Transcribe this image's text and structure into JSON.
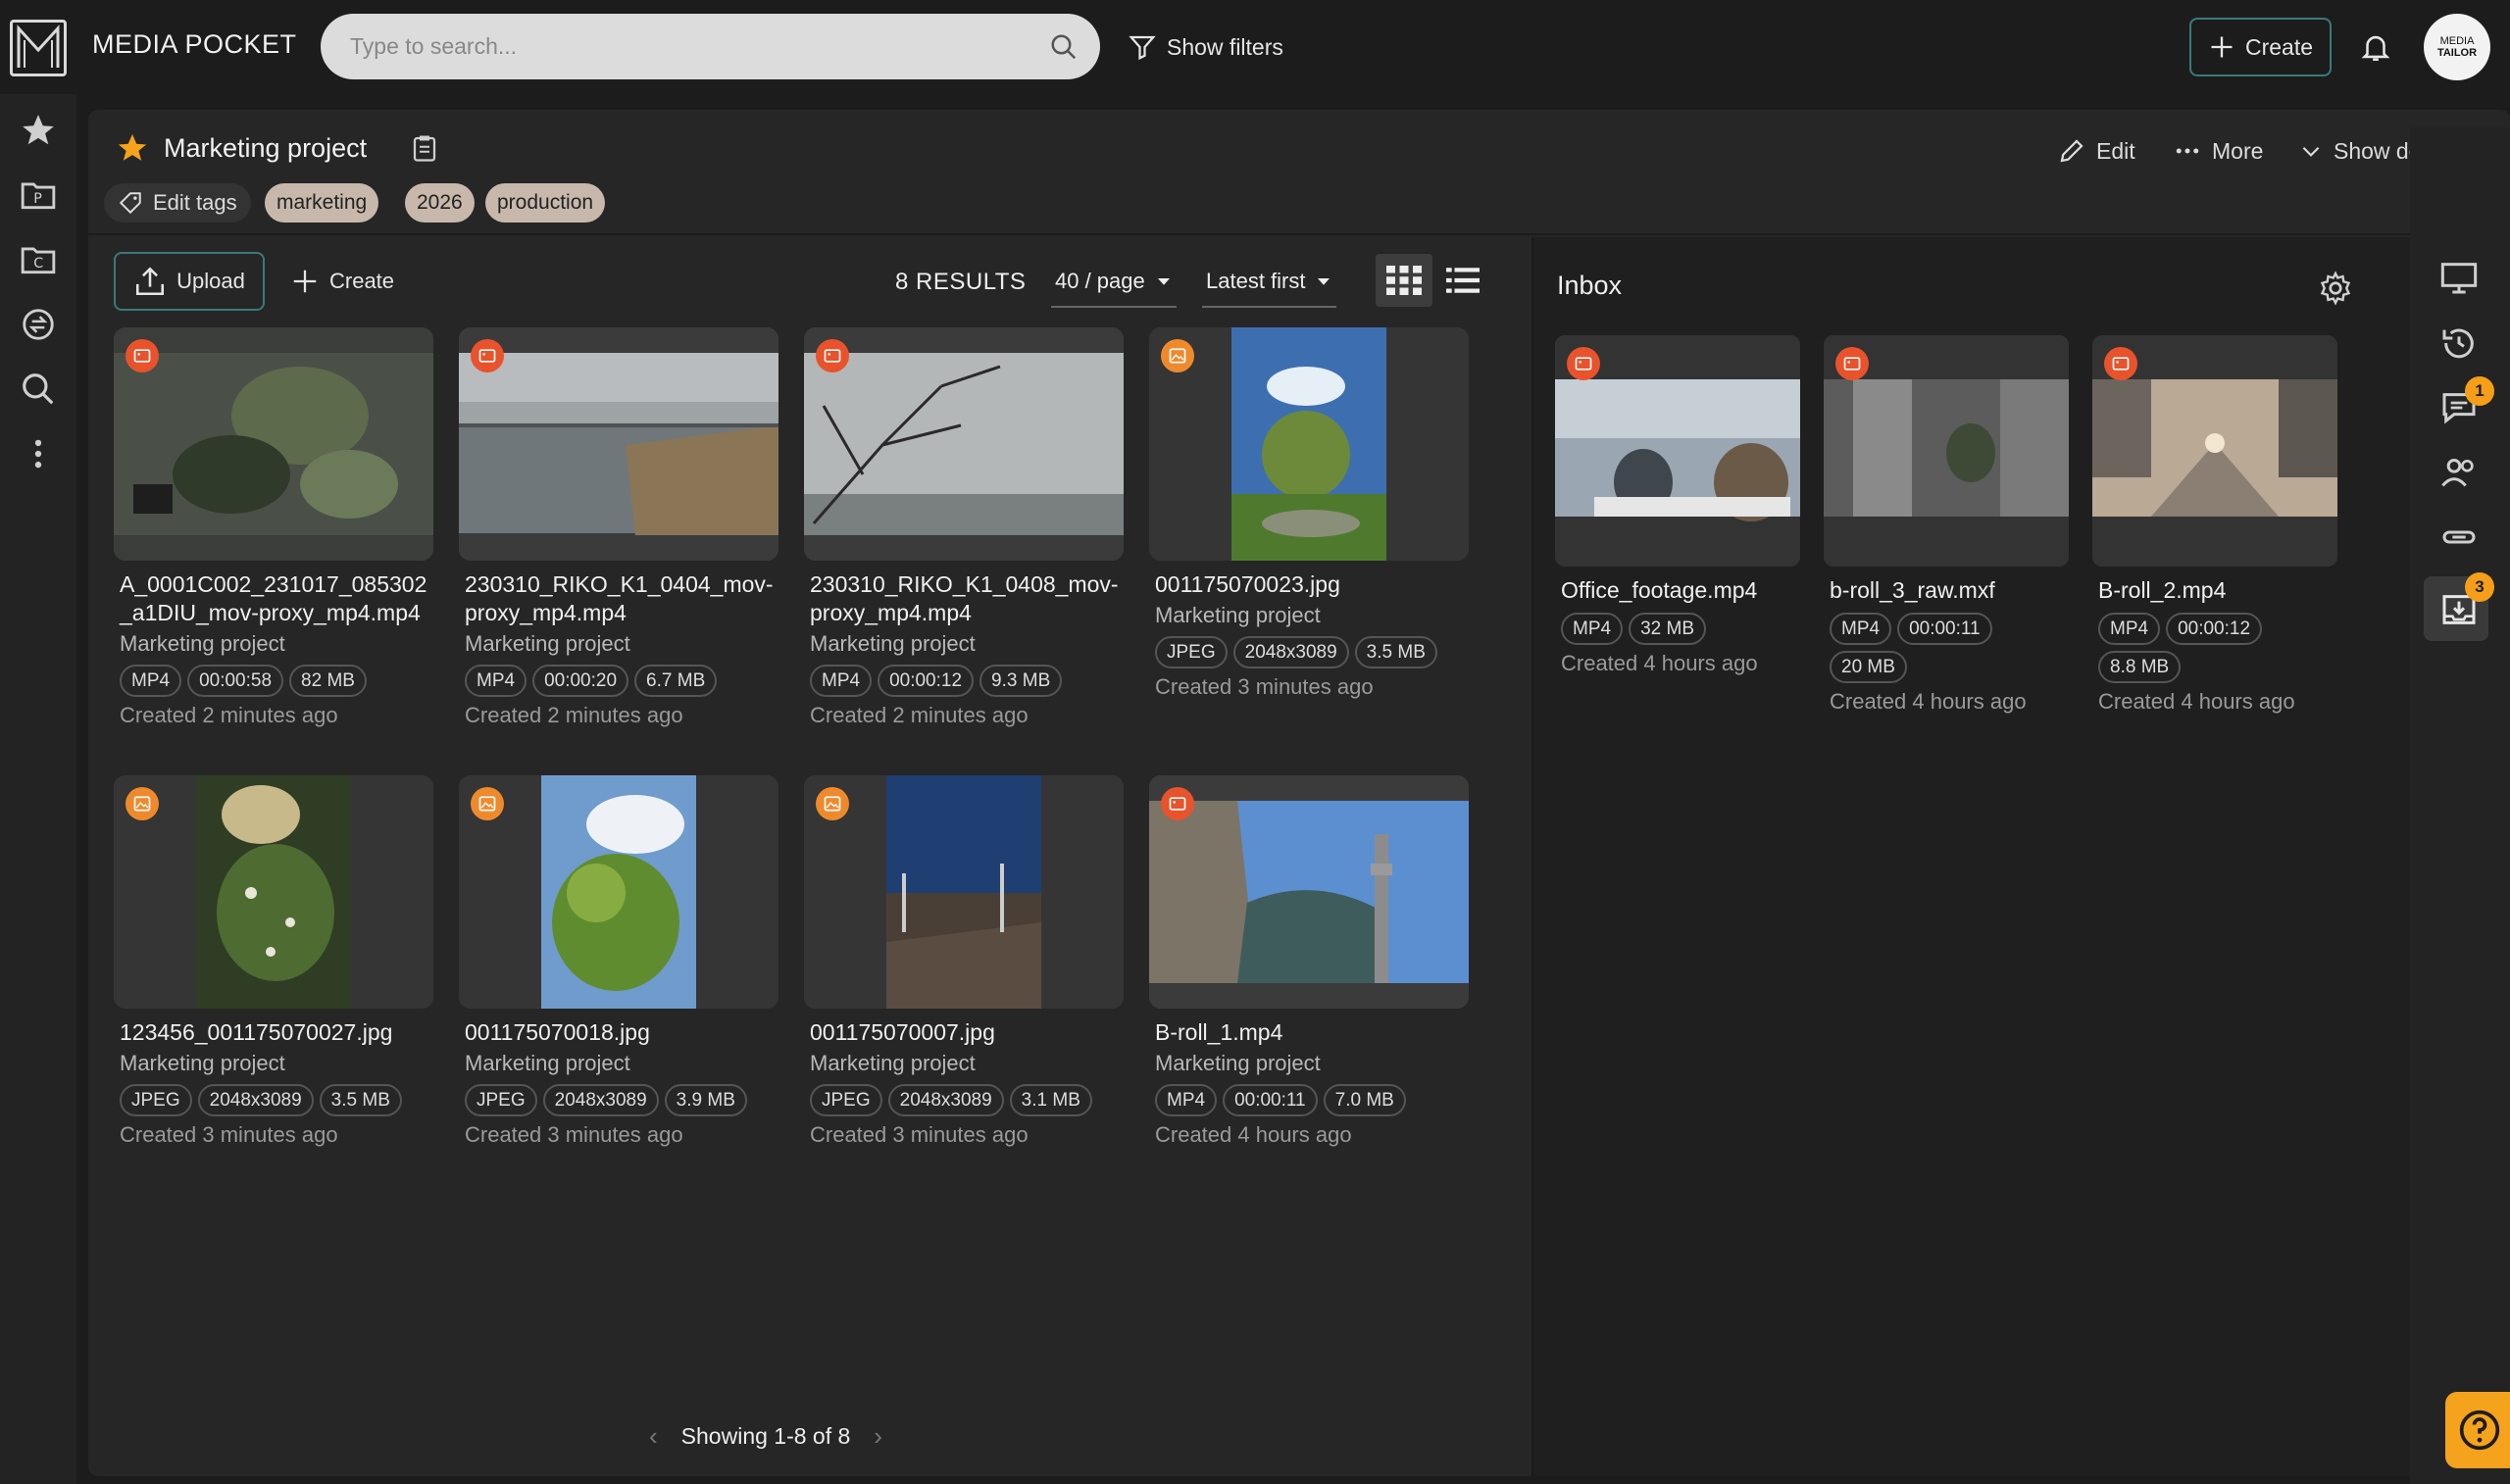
{
  "app": {
    "title": "MEDIA POCKET"
  },
  "search": {
    "placeholder": "Type to search..."
  },
  "topbar": {
    "show_filters": "Show filters",
    "create": "Create",
    "avatar_line1": "MEDIA",
    "avatar_line2": "TAILOR"
  },
  "project": {
    "title": "Marketing project",
    "edit_tags": "Edit tags",
    "tags": [
      "marketing",
      "2026",
      "production"
    ],
    "edit": "Edit",
    "more": "More",
    "show_details": "Show details"
  },
  "toolbar": {
    "upload": "Upload",
    "create": "Create",
    "results": "8 RESULTS",
    "per_page": "40 / page",
    "sort": "Latest first"
  },
  "cards": [
    {
      "name": "A_0001C002_231017_085302_a1DIU_mov-proxy_mp4.mp4",
      "project": "Marketing project",
      "chips": [
        "MP4",
        "00:00:58",
        "82 MB"
      ],
      "created": "Created 2 minutes ago",
      "kind": "video"
    },
    {
      "name": "230310_RIKO_K1_0404_mov-proxy_mp4.mp4",
      "project": "Marketing project",
      "chips": [
        "MP4",
        "00:00:20",
        "6.7 MB"
      ],
      "created": "Created 2 minutes ago",
      "kind": "video"
    },
    {
      "name": "230310_RIKO_K1_0408_mov-proxy_mp4.mp4",
      "project": "Marketing project",
      "chips": [
        "MP4",
        "00:00:12",
        "9.3 MB"
      ],
      "created": "Created 2 minutes ago",
      "kind": "video"
    },
    {
      "name": "001175070023.jpg",
      "project": "Marketing project",
      "chips": [
        "JPEG",
        "2048x3089",
        "3.5 MB"
      ],
      "created": "Created 3 minutes ago",
      "kind": "image"
    },
    {
      "name": "123456_001175070027.jpg",
      "project": "Marketing project",
      "chips": [
        "JPEG",
        "2048x3089",
        "3.5 MB"
      ],
      "created": "Created 3 minutes ago",
      "kind": "image"
    },
    {
      "name": "001175070018.jpg",
      "project": "Marketing project",
      "chips": [
        "JPEG",
        "2048x3089",
        "3.9 MB"
      ],
      "created": "Created 3 minutes ago",
      "kind": "image"
    },
    {
      "name": "001175070007.jpg",
      "project": "Marketing project",
      "chips": [
        "JPEG",
        "2048x3089",
        "3.1 MB"
      ],
      "created": "Created 3 minutes ago",
      "kind": "image"
    },
    {
      "name": "B-roll_1.mp4",
      "project": "Marketing project",
      "chips": [
        "MP4",
        "00:00:11",
        "7.0 MB"
      ],
      "created": "Created 4 hours ago",
      "kind": "video"
    }
  ],
  "pager": {
    "text": "Showing 1-8 of 8"
  },
  "inbox": {
    "title": "Inbox",
    "items": [
      {
        "name": "Office_footage.mp4",
        "chips": [
          "MP4",
          "32 MB"
        ],
        "created": "Created 4 hours ago"
      },
      {
        "name": "b-roll_3_raw.mxf",
        "chips": [
          "MP4",
          "00:00:11",
          "20 MB"
        ],
        "created": "Created 4 hours ago"
      },
      {
        "name": "B-roll_2.mp4",
        "chips": [
          "MP4",
          "00:00:12",
          "8.8 MB"
        ],
        "created": "Created 4 hours ago"
      }
    ]
  },
  "rightrail": {
    "comments_badge": "1",
    "inbox_badge": "3"
  },
  "colors": {
    "accent": "#3a7a78",
    "video_badge": "#e8532c",
    "image_badge": "#ef8a2c",
    "notify": "#f59e1a",
    "tag_bg": "#c8b8ab"
  },
  "icons": [
    "search-icon",
    "filter-icon",
    "plus-icon",
    "bell-icon",
    "star-icon",
    "clipboard-icon",
    "tag-icon",
    "pencil-icon",
    "dots-icon",
    "chevron-down-icon",
    "upload-icon",
    "grid-icon",
    "list-icon",
    "gear-icon",
    "video-icon",
    "image-icon",
    "help-icon"
  ]
}
